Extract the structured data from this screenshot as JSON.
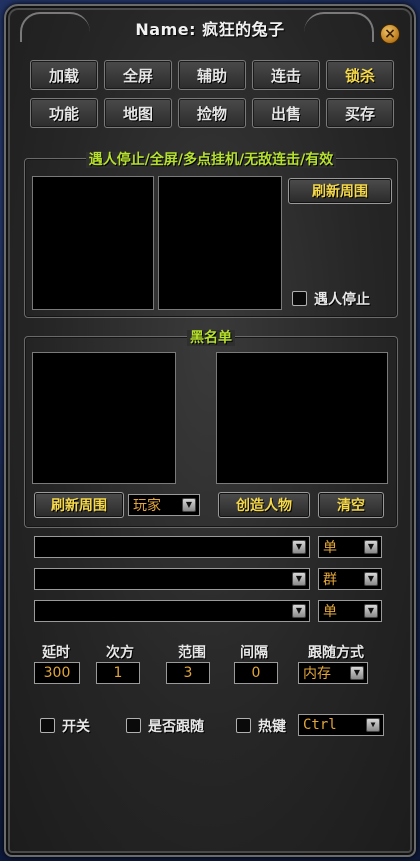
{
  "window": {
    "title": "Name: 疯狂的兔子"
  },
  "tabs_row1": [
    {
      "label": "加载",
      "active": false
    },
    {
      "label": "全屏",
      "active": false
    },
    {
      "label": "辅助",
      "active": false
    },
    {
      "label": "连击",
      "active": false
    },
    {
      "label": "锁杀",
      "active": true
    }
  ],
  "tabs_row2": [
    {
      "label": "功能"
    },
    {
      "label": "地图"
    },
    {
      "label": "捡物"
    },
    {
      "label": "出售"
    },
    {
      "label": "买存"
    }
  ],
  "stop_group": {
    "title": "遇人停止/全屏/多点挂机/无敌连击/有效",
    "refresh_label": "刷新周围",
    "stop_checkbox_label": "遇人停止",
    "stop_checked": false
  },
  "blacklist": {
    "title": "黑名单",
    "refresh_label": "刷新周围",
    "type_select": "玩家",
    "create_label": "创造人物",
    "clear_label": "清空",
    "rows": [
      {
        "value": "",
        "mode": "单"
      },
      {
        "value": "",
        "mode": "群"
      },
      {
        "value": "",
        "mode": "单"
      }
    ]
  },
  "params": {
    "delay_label": "延时",
    "delay_value": "300",
    "times_label": "次方",
    "times_value": "1",
    "range_label": "范围",
    "range_value": "3",
    "interval_label": "间隔",
    "interval_value": "0",
    "follow_mode_label": "跟随方式",
    "follow_mode_value": "内存"
  },
  "bottom": {
    "switch_label": "开关",
    "follow_label": "是否跟随",
    "hotkey_label": "热键",
    "hotkey_value": "Ctrl"
  },
  "icons": {
    "close": "close-icon",
    "dropdown": "chevron-down-icon"
  },
  "colors": {
    "accent_yellow": "#f5d94a",
    "group_title_green": "#b6e02e",
    "input_orange": "#e2a63a"
  }
}
